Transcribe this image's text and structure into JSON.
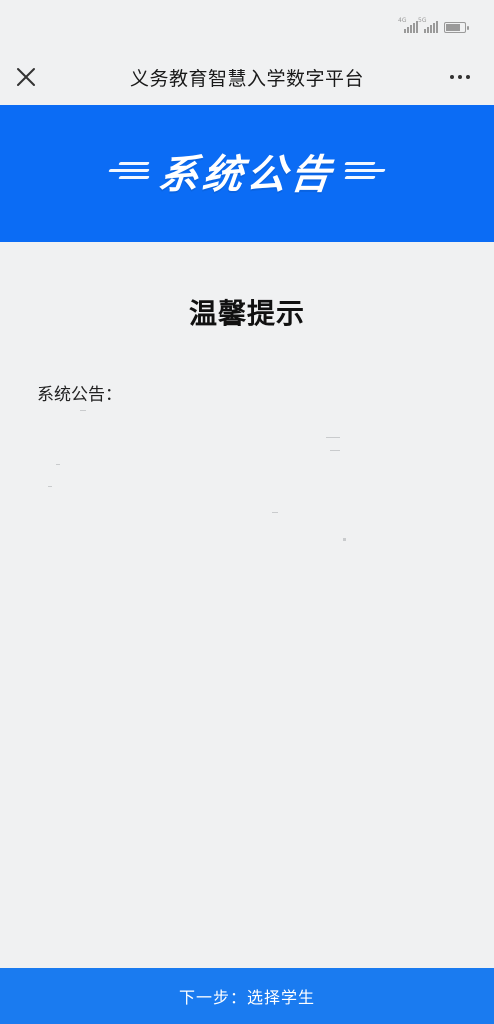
{
  "status_bar": {
    "signal_1_tag": "4G",
    "signal_2_tag": "5G",
    "icons": [
      "signal-icon",
      "signal-icon",
      "battery-icon"
    ]
  },
  "nav": {
    "title": "义务教育智慧入学数字平台",
    "close_icon": "close-icon",
    "more_icon": "more-icon"
  },
  "banner": {
    "title": "系统公告",
    "color": "#0b6cf5"
  },
  "notice": {
    "heading": "温馨提示",
    "label": "系统公告："
  },
  "footer": {
    "next_label": "下一步：选择学生",
    "color": "#1a7bf0"
  }
}
